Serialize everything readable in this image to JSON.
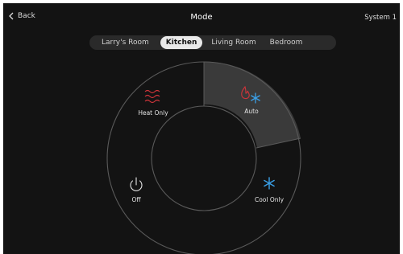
{
  "header": {
    "back_label": "Back",
    "title": "Mode",
    "system_label": "System 1"
  },
  "rooms": {
    "items": [
      "Larry's Room",
      "Kitchen",
      "Living Room",
      "Bedroom"
    ],
    "selected": "Kitchen"
  },
  "modes": {
    "heat_only": "Heat Only",
    "auto": "Auto",
    "cool_only": "Cool Only",
    "off": "Off",
    "selected": "Auto"
  },
  "colors": {
    "background": "#131313",
    "selected_segment": "#3a3a3a",
    "heat": "#d0343a",
    "cool": "#3aa0e8"
  }
}
